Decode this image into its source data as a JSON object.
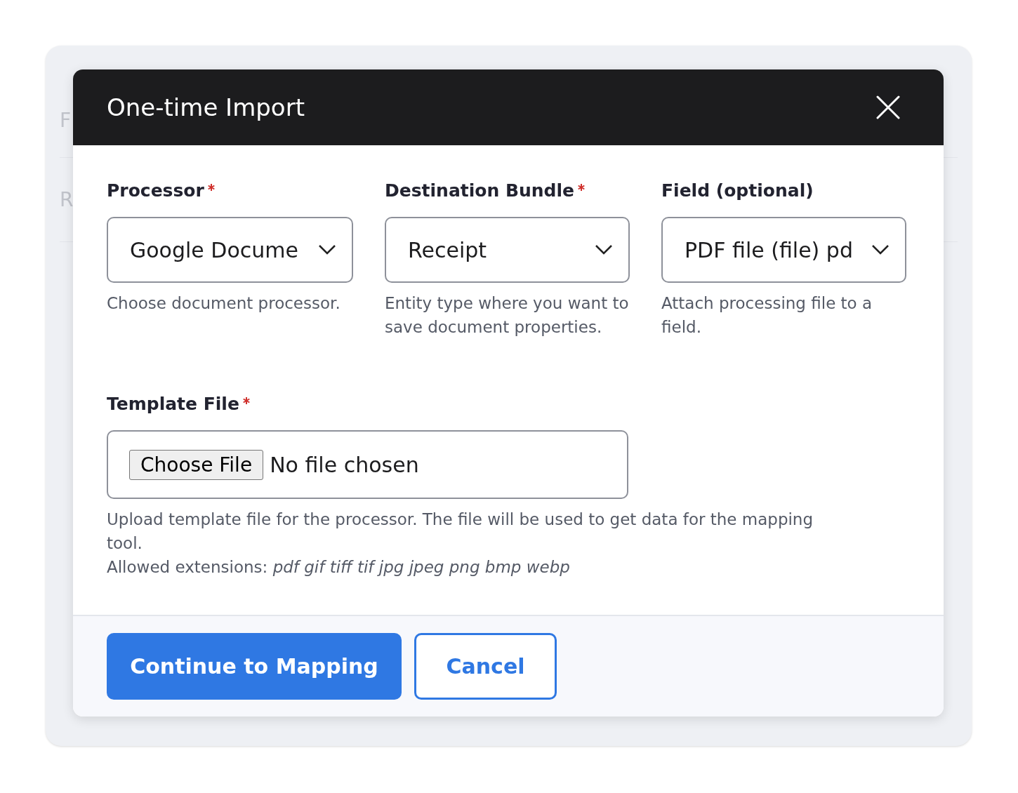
{
  "background": {
    "rows": [
      {
        "label": "F"
      },
      {
        "label": "R"
      }
    ]
  },
  "dialog": {
    "title": "One-time Import",
    "fields": [
      {
        "label": "Processor",
        "required": true,
        "value": "Google Docume",
        "description": "Choose document processor."
      },
      {
        "label": "Destination Bundle",
        "required": true,
        "value": "Receipt",
        "description": "Entity type where you want to save document properties."
      },
      {
        "label": "Field (optional)",
        "required": false,
        "value": "PDF file (file) pd",
        "description": "Attach processing file to a field."
      }
    ],
    "file_field": {
      "label": "Template File",
      "required": true,
      "button": "Choose File",
      "status": "No file chosen",
      "description": "Upload template file for the processor. The file will be used to get data for the mapping tool.",
      "extensions": "Allowed extensions: *pdf gif tiff tif jpg jpeg png bmp webp*"
    },
    "buttons": [
      {
        "label": "Continue to Mapping",
        "kind": "primary"
      },
      {
        "label": "Cancel",
        "kind": "secondary"
      }
    ]
  }
}
